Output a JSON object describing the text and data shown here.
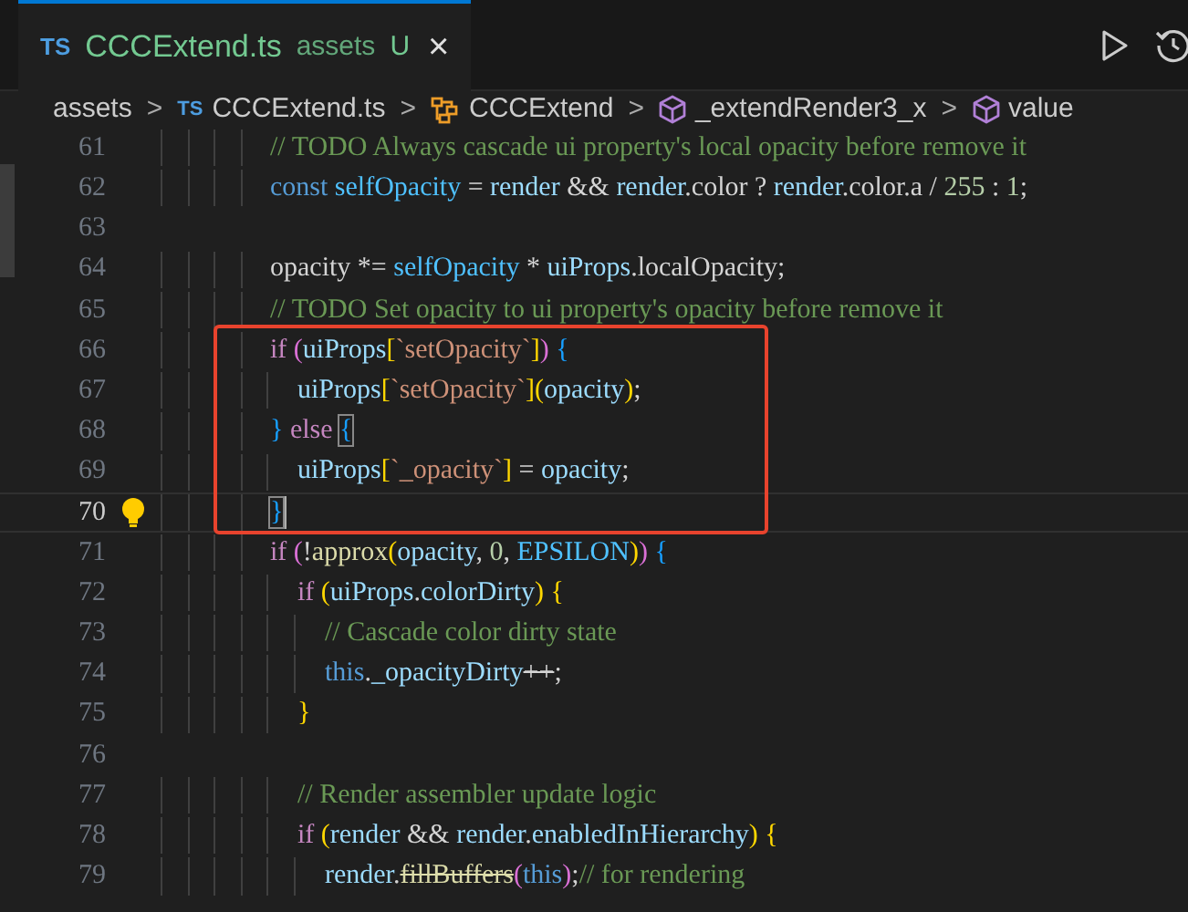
{
  "tab": {
    "icon_text": "TS",
    "filename": "CCCExtend.ts",
    "folder": "assets",
    "badge": "U",
    "close": "×",
    "selected": true
  },
  "breadcrumbs": [
    {
      "kind": "folder",
      "label": "assets"
    },
    {
      "kind": "ts",
      "icon_text": "TS",
      "label": "CCCExtend.ts"
    },
    {
      "kind": "class",
      "label": "CCCExtend"
    },
    {
      "kind": "member",
      "label": "_extendRender3_x"
    },
    {
      "kind": "member",
      "label": "value"
    }
  ],
  "breadcrumb_separator": ">",
  "lines": [
    {
      "number": "61",
      "current": false,
      "tokens": [
        {
          "kind": "c",
          "text": "                // TODO Always cascade ui property's local opacity before remove it"
        }
      ]
    },
    {
      "number": "62",
      "current": false,
      "tokens": [
        {
          "kind": "st",
          "text": "                const"
        },
        {
          "kind": "cn",
          "text": " selfOpacity"
        },
        {
          "kind": "p",
          "text": " = "
        },
        {
          "kind": "v",
          "text": "render"
        },
        {
          "kind": "p",
          "text": " && "
        },
        {
          "kind": "v",
          "text": "render"
        },
        {
          "kind": "p",
          "text": ".color ? "
        },
        {
          "kind": "v",
          "text": "render"
        },
        {
          "kind": "p",
          "text": ".color.a / "
        },
        {
          "kind": "n",
          "text": "255"
        },
        {
          "kind": "p",
          "text": " : "
        },
        {
          "kind": "n",
          "text": "1"
        },
        {
          "kind": "p",
          "text": ";"
        }
      ]
    },
    {
      "number": "63",
      "current": false
    },
    {
      "number": "64",
      "current": false,
      "tokens": [
        {
          "kind": "p",
          "text": "                opacity *= "
        },
        {
          "kind": "cn",
          "text": "selfOpacity"
        },
        {
          "kind": "p",
          "text": " * "
        },
        {
          "kind": "v",
          "text": "uiProps"
        },
        {
          "kind": "p",
          "text": ".localOpacity;"
        }
      ]
    },
    {
      "number": "65",
      "current": false,
      "tokens": [
        {
          "kind": "c",
          "text": "                // TODO Set opacity to ui property's opacity before remove it"
        }
      ]
    },
    {
      "number": "66",
      "current": false,
      "tokens": [
        {
          "kind": "kw",
          "text": "                if"
        },
        {
          "kind": "b2",
          "text": " ("
        },
        {
          "kind": "v",
          "text": "uiProps"
        },
        {
          "kind": "b1",
          "text": "["
        },
        {
          "kind": "s",
          "text": "`setOpacity`"
        },
        {
          "kind": "b1",
          "text": "]"
        },
        {
          "kind": "b2",
          "text": ")"
        },
        {
          "kind": "b3",
          "text": " {"
        }
      ]
    },
    {
      "number": "67",
      "current": false,
      "tokens": [
        {
          "kind": "v",
          "text": "                    uiProps"
        },
        {
          "kind": "b1",
          "text": "["
        },
        {
          "kind": "s",
          "text": "`setOpacity`"
        },
        {
          "kind": "b1",
          "text": "]"
        },
        {
          "kind": "b1",
          "text": "("
        },
        {
          "kind": "v",
          "text": "opacity"
        },
        {
          "kind": "b1",
          "text": ")"
        },
        {
          "kind": "p",
          "text": ";"
        }
      ]
    },
    {
      "number": "68",
      "current": false,
      "tokens": [
        {
          "kind": "b3",
          "text": "                }"
        },
        {
          "kind": "kw",
          "text": " else "
        },
        {
          "kind": "b3m",
          "text": "{"
        }
      ]
    },
    {
      "number": "69",
      "current": false,
      "tokens": [
        {
          "kind": "v",
          "text": "                    uiProps"
        },
        {
          "kind": "b1",
          "text": "["
        },
        {
          "kind": "s",
          "text": "`_opacity`"
        },
        {
          "kind": "b1",
          "text": "]"
        },
        {
          "kind": "p",
          "text": " = "
        },
        {
          "kind": "v",
          "text": "opacity"
        },
        {
          "kind": "p",
          "text": ";"
        }
      ]
    },
    {
      "number": "70",
      "current": true,
      "lightbulb": true,
      "tokens": [
        {
          "kind": "b3m",
          "text": "                }"
        }
      ]
    },
    {
      "number": "71",
      "current": false,
      "tokens": [
        {
          "kind": "kw",
          "text": "                if"
        },
        {
          "kind": "b2",
          "text": " ("
        },
        {
          "kind": "p",
          "text": "!"
        },
        {
          "kind": "f",
          "text": "approx"
        },
        {
          "kind": "b1",
          "text": "("
        },
        {
          "kind": "v",
          "text": "opacity"
        },
        {
          "kind": "p",
          "text": ", "
        },
        {
          "kind": "n",
          "text": "0"
        },
        {
          "kind": "p",
          "text": ", "
        },
        {
          "kind": "cn",
          "text": "EPSILON"
        },
        {
          "kind": "b1",
          "text": ")"
        },
        {
          "kind": "b2",
          "text": ")"
        },
        {
          "kind": "b3",
          "text": " {"
        }
      ]
    },
    {
      "number": "72",
      "current": false,
      "tokens": [
        {
          "kind": "kw",
          "text": "                    if"
        },
        {
          "kind": "b1",
          "text": " ("
        },
        {
          "kind": "v",
          "text": "uiProps"
        },
        {
          "kind": "p",
          "text": "."
        },
        {
          "kind": "v",
          "text": "colorDirty"
        },
        {
          "kind": "b1",
          "text": ")"
        },
        {
          "kind": "b1",
          "text": " {"
        }
      ]
    },
    {
      "number": "73",
      "current": false,
      "tokens": [
        {
          "kind": "c",
          "text": "                        // Cascade color dirty state"
        }
      ]
    },
    {
      "number": "74",
      "current": false,
      "tokens": [
        {
          "kind": "st",
          "text": "                        this"
        },
        {
          "kind": "p",
          "text": "."
        },
        {
          "kind": "v",
          "text": "_opacityDirty"
        },
        {
          "kind": "ps",
          "text": "++"
        },
        {
          "kind": "p",
          "text": ";"
        }
      ]
    },
    {
      "number": "75",
      "current": false,
      "tokens": [
        {
          "kind": "b1",
          "text": "                    }"
        }
      ]
    },
    {
      "number": "76",
      "current": false
    },
    {
      "number": "77",
      "current": false,
      "tokens": [
        {
          "kind": "c",
          "text": "                    // Render assembler update logic"
        }
      ]
    },
    {
      "number": "78",
      "current": false,
      "tokens": [
        {
          "kind": "kw",
          "text": "                    if"
        },
        {
          "kind": "b1",
          "text": " ("
        },
        {
          "kind": "v",
          "text": "render"
        },
        {
          "kind": "p",
          "text": " && "
        },
        {
          "kind": "v",
          "text": "render"
        },
        {
          "kind": "p",
          "text": "."
        },
        {
          "kind": "v",
          "text": "enabledInHierarchy"
        },
        {
          "kind": "b1",
          "text": ")"
        },
        {
          "kind": "b1",
          "text": " {"
        }
      ]
    },
    {
      "number": "79",
      "current": false,
      "tokens": [
        {
          "kind": "v",
          "text": "                        render"
        },
        {
          "kind": "p",
          "text": "."
        },
        {
          "kind": "fs",
          "text": "fillBuffers"
        },
        {
          "kind": "b2",
          "text": "("
        },
        {
          "kind": "st",
          "text": "this"
        },
        {
          "kind": "b2",
          "text": ")"
        },
        {
          "kind": "p",
          "text": ";"
        },
        {
          "kind": "c",
          "text": "// for rendering"
        }
      ]
    }
  ]
}
